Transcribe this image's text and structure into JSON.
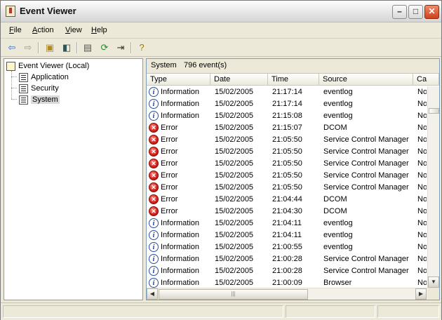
{
  "window": {
    "title": "Event Viewer",
    "min": "–",
    "max": "□",
    "close": "✕"
  },
  "menu": [
    {
      "label": "File",
      "u": "F",
      "rest": "ile"
    },
    {
      "label": "Action",
      "u": "A",
      "rest": "ction"
    },
    {
      "label": "View",
      "u": "V",
      "rest": "iew"
    },
    {
      "label": "Help",
      "u": "H",
      "rest": "elp"
    }
  ],
  "toolbar": {
    "icons": [
      "back-arrow-icon",
      "forward-arrow-icon",
      "up-folder-icon",
      "show-tree-icon",
      "properties-icon",
      "refresh-icon",
      "export-list-icon",
      "help-icon"
    ]
  },
  "tree": {
    "root": "Event Viewer (Local)",
    "items": [
      "Application",
      "Security",
      "System"
    ],
    "selected": "System"
  },
  "list": {
    "log_name": "System",
    "event_count": "796 event(s)",
    "columns": [
      "Type",
      "Date",
      "Time",
      "Source",
      "Ca"
    ],
    "rows": [
      {
        "type": "Information",
        "date": "15/02/2005",
        "time": "21:17:14",
        "source": "eventlog",
        "cat": "No"
      },
      {
        "type": "Information",
        "date": "15/02/2005",
        "time": "21:17:14",
        "source": "eventlog",
        "cat": "No"
      },
      {
        "type": "Information",
        "date": "15/02/2005",
        "time": "21:15:08",
        "source": "eventlog",
        "cat": "No"
      },
      {
        "type": "Error",
        "date": "15/02/2005",
        "time": "21:15:07",
        "source": "DCOM",
        "cat": "No"
      },
      {
        "type": "Error",
        "date": "15/02/2005",
        "time": "21:05:50",
        "source": "Service Control Manager",
        "cat": "No"
      },
      {
        "type": "Error",
        "date": "15/02/2005",
        "time": "21:05:50",
        "source": "Service Control Manager",
        "cat": "No"
      },
      {
        "type": "Error",
        "date": "15/02/2005",
        "time": "21:05:50",
        "source": "Service Control Manager",
        "cat": "No"
      },
      {
        "type": "Error",
        "date": "15/02/2005",
        "time": "21:05:50",
        "source": "Service Control Manager",
        "cat": "No"
      },
      {
        "type": "Error",
        "date": "15/02/2005",
        "time": "21:05:50",
        "source": "Service Control Manager",
        "cat": "No"
      },
      {
        "type": "Error",
        "date": "15/02/2005",
        "time": "21:04:44",
        "source": "DCOM",
        "cat": "No"
      },
      {
        "type": "Error",
        "date": "15/02/2005",
        "time": "21:04:30",
        "source": "DCOM",
        "cat": "No"
      },
      {
        "type": "Information",
        "date": "15/02/2005",
        "time": "21:04:11",
        "source": "eventlog",
        "cat": "No"
      },
      {
        "type": "Information",
        "date": "15/02/2005",
        "time": "21:04:11",
        "source": "eventlog",
        "cat": "No"
      },
      {
        "type": "Information",
        "date": "15/02/2005",
        "time": "21:00:55",
        "source": "eventlog",
        "cat": "No"
      },
      {
        "type": "Information",
        "date": "15/02/2005",
        "time": "21:00:28",
        "source": "Service Control Manager",
        "cat": "No"
      },
      {
        "type": "Information",
        "date": "15/02/2005",
        "time": "21:00:28",
        "source": "Service Control Manager",
        "cat": "No"
      },
      {
        "type": "Information",
        "date": "15/02/2005",
        "time": "21:00:09",
        "source": "Browser",
        "cat": "No"
      }
    ]
  },
  "colors": {
    "info": "#1d3a8a",
    "error": "#d2201a",
    "titlebar": "#e4e4e4",
    "panel": "#ece9d8"
  }
}
